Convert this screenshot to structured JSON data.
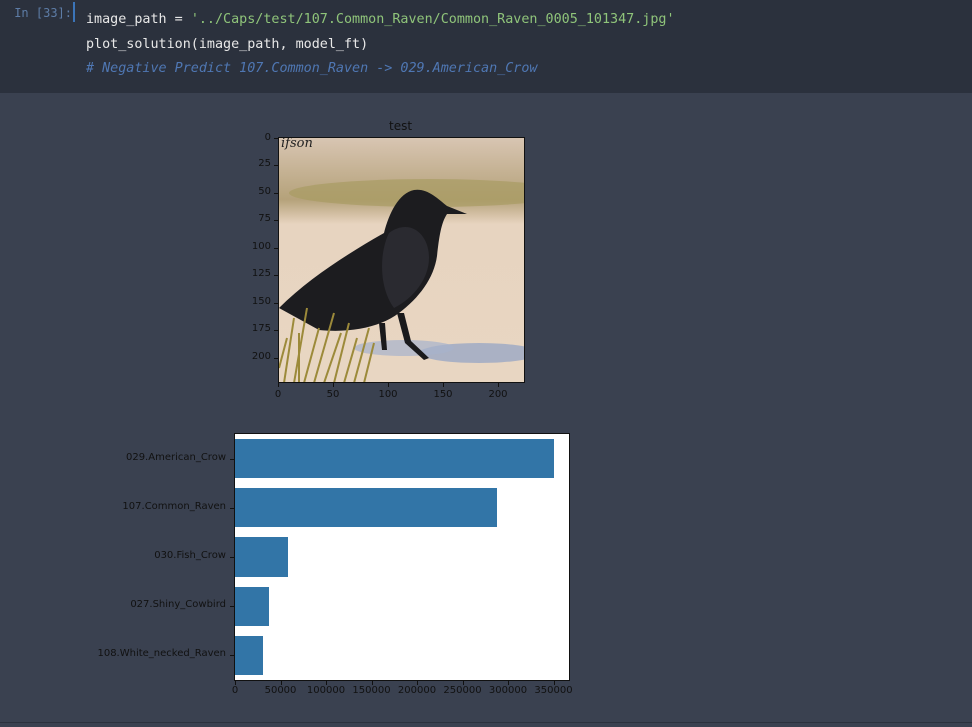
{
  "cell": {
    "prompt": "In [33]:",
    "code": {
      "line1_prefix": "image_path = ",
      "line1_string": "'../Caps/test/107.Common_Raven/Common_Raven_0005_101347.jpg'",
      "line2": "plot_solution(image_path, model_ft)",
      "line3_comment": "# Negative Predict 107.Common_Raven -> 029.American_Crow"
    }
  },
  "image_plot": {
    "title": "test",
    "watermark": "ifson",
    "y_ticks": [
      "0",
      "25",
      "50",
      "75",
      "100",
      "125",
      "150",
      "175",
      "200"
    ],
    "x_ticks": [
      "0",
      "50",
      "100",
      "150",
      "200"
    ]
  },
  "chart_data": {
    "type": "bar",
    "orientation": "horizontal",
    "categories": [
      "029.American_Crow",
      "107.Common_Raven",
      "030.Fish_Crow",
      "027.Shiny_Cowbird",
      "108.White_necked_Raven"
    ],
    "values": [
      350000,
      288000,
      58000,
      37000,
      31000
    ],
    "xlim": [
      0,
      367000
    ],
    "x_ticks": [
      "0",
      "50000",
      "100000",
      "150000",
      "200000",
      "250000",
      "300000",
      "350000"
    ],
    "bar_color": "#3275a7"
  },
  "colors": {
    "code_background": "#2b313d",
    "output_background": "#3a4150",
    "string": "#8fc47a",
    "comment": "#4f77b3"
  }
}
